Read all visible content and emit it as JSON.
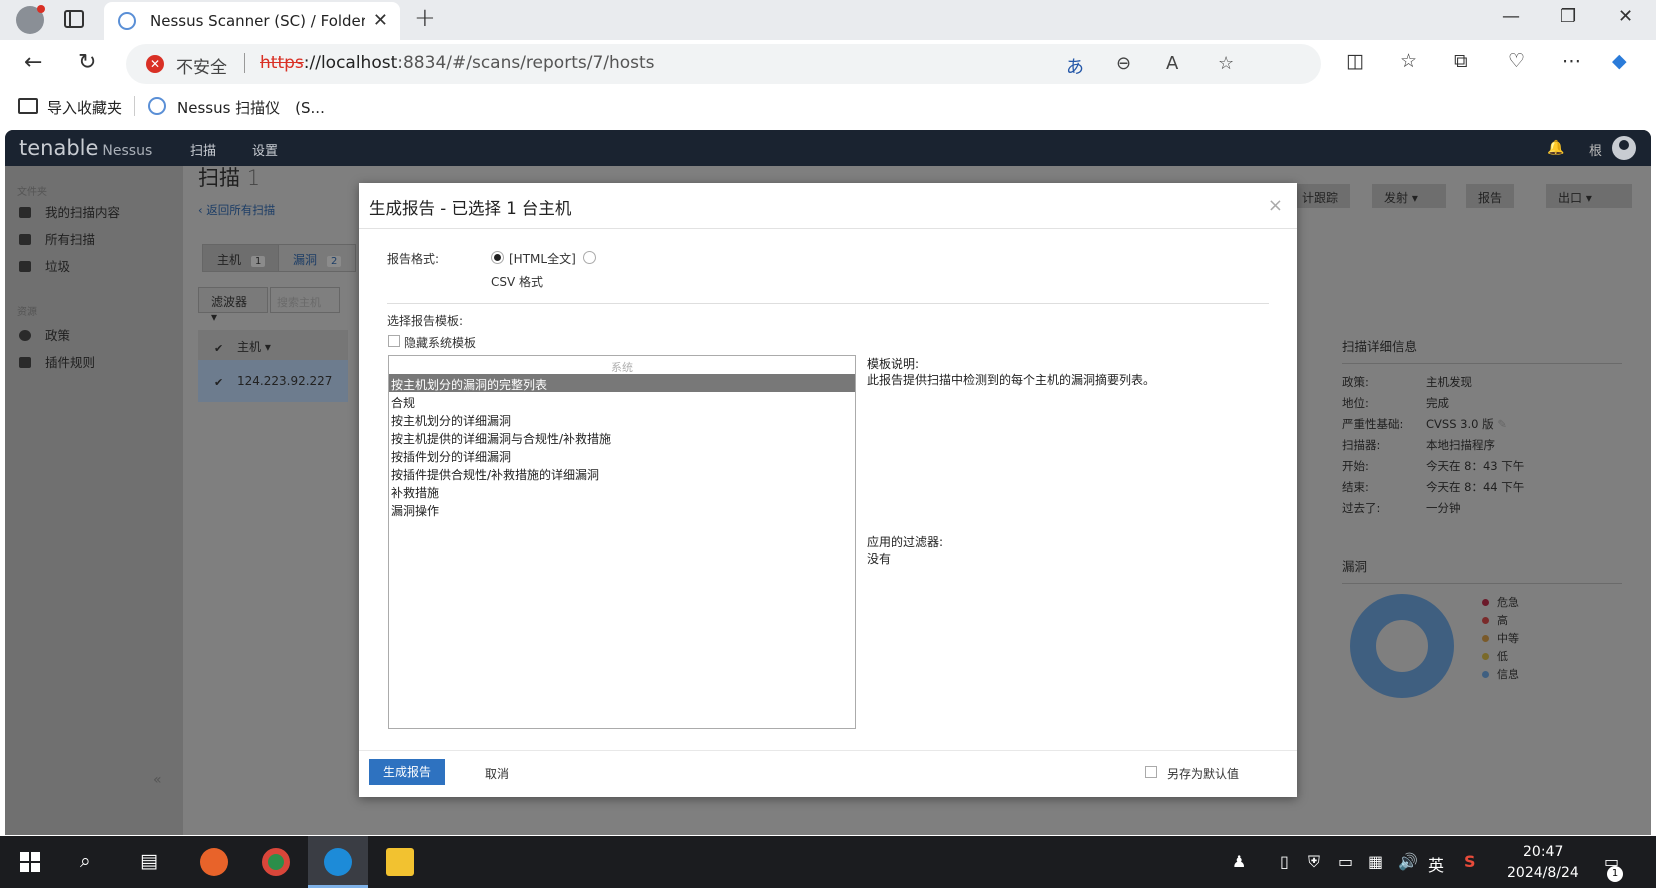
{
  "browser": {
    "tab_title": "Nessus Scanner (SC) / Folders / V",
    "insecure_label": "不安全",
    "url_scheme": "https",
    "url_host": "://localhost",
    "url_rest": ":8834/#/scans/reports/7/hosts",
    "favorites": [
      {
        "label": "导入收藏夹"
      },
      {
        "label": "Nessus 扫描仪　(S..."
      }
    ]
  },
  "app": {
    "logo": "tenable",
    "logo_sub": "Nessus",
    "nav": [
      "扫描",
      "设置"
    ],
    "user": "根"
  },
  "sidebar": {
    "folders_head": "文件夹",
    "folders": [
      {
        "label": "我的扫描内容"
      },
      {
        "label": "所有扫描"
      },
      {
        "label": "垃圾"
      }
    ],
    "resources_head": "资源",
    "resources": [
      {
        "label": "政策"
      },
      {
        "label": "插件规则"
      }
    ],
    "collapse": "«"
  },
  "scan": {
    "title": "扫描",
    "title_num": "1",
    "back": "‹ 返回所有扫描",
    "tab_hosts": "主机",
    "tab_hosts_count": "1",
    "tab_vulns": "漏洞",
    "tab_vulns_count": "2",
    "filter": "滤波器 ▾",
    "search_placeholder": "搜索主机",
    "col_host": "主机 ▾",
    "host_ip": "124.223.92.227",
    "top_buttons": [
      "计跟踪",
      "发射 ▾",
      "报告",
      "出口 ▾"
    ]
  },
  "details": {
    "title": "扫描详细信息",
    "rows": [
      {
        "k": "政策:",
        "v": "主机发现"
      },
      {
        "k": "地位:",
        "v": "完成"
      },
      {
        "k": "严重性基础:",
        "v": "CVSS 3.0 版"
      },
      {
        "k": "扫描器:",
        "v": "本地扫描程序"
      },
      {
        "k": "开始:",
        "v": "今天在 8：43 下午"
      },
      {
        "k": "结束:",
        "v": "今天在 8：44 下午"
      },
      {
        "k": "过去了:",
        "v": "一分钟"
      }
    ],
    "vuln_title": "漏洞",
    "legend": [
      {
        "label": "危急",
        "color": "#6b1a2a"
      },
      {
        "label": "高",
        "color": "#7a2a2a"
      },
      {
        "label": "中等",
        "color": "#7a5a2a"
      },
      {
        "label": "低",
        "color": "#7a6a2a"
      },
      {
        "label": "信息",
        "color": "#3f5f80"
      }
    ]
  },
  "modal": {
    "title": "生成报告 - 已选择 1 台主机",
    "format_label": "报告格式:",
    "format_html": "[HTML全文]",
    "format_csv": "CSV 格式",
    "template_label": "选择报告模板:",
    "hide_system": "隐藏系统模板",
    "group_system": "系统",
    "templates": [
      "按主机划分的漏洞的完整列表",
      "合规",
      "按主机划分的详细漏洞",
      "按主机提供的详细漏洞与合规性/补救措施",
      "按插件划分的详细漏洞",
      "按插件提供合规性/补救措施的详细漏洞",
      "补救措施",
      "漏洞操作"
    ],
    "selected_index": 0,
    "desc_label": "模板说明:",
    "desc_text": "此报告提供扫描中检测到的每个主机的漏洞摘要列表。",
    "filters_label": "应用的过滤器:",
    "filters_value": "没有",
    "generate": "生成报告",
    "cancel": "取消",
    "save_default": "另存为默认值"
  },
  "taskbar": {
    "ime": "英",
    "time": "20:47",
    "date": "2024/8/24",
    "notifications": "1"
  }
}
